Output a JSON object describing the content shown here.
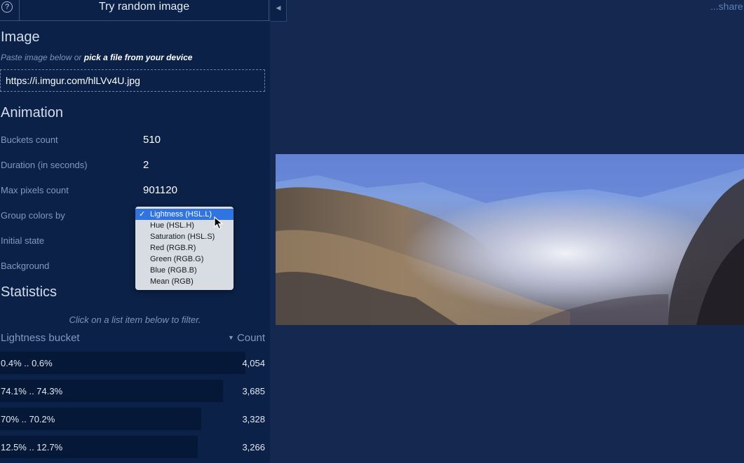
{
  "topbar": {
    "help_icon": "?",
    "random_button": "Try random image",
    "collapse_icon": "chevron-left-icon"
  },
  "image_section": {
    "title": "Image",
    "hint_prefix": "Paste image below or ",
    "hint_link": "pick a file from your device",
    "url_value": "https://i.imgur.com/hlLVv4U.jpg"
  },
  "animation": {
    "title": "Animation",
    "rows": [
      {
        "label": "Buckets count",
        "value": "510"
      },
      {
        "label": "Duration (in seconds)",
        "value": "2"
      },
      {
        "label": "Max pixels count",
        "value": "901120"
      },
      {
        "label": "Group colors by",
        "value": "Lightness (HSL.L)"
      },
      {
        "label": "Initial state",
        "value": ""
      },
      {
        "label": "Background",
        "value": ""
      }
    ],
    "group_by_options": [
      "Lightness (HSL.L)",
      "Hue (HSL.H)",
      "Saturation (HSL.S)",
      "Red (RGB.R)",
      "Green (RGB.G)",
      "Blue (RGB.B)",
      "Mean (RGB)"
    ],
    "selected_option_index": 0
  },
  "statistics": {
    "title": "Statistics",
    "hint": "Click on a list item below to filter.",
    "column_bucket": "Lightness bucket",
    "column_count": "Count",
    "rows": [
      {
        "bucket": "0.4% .. 0.6%",
        "count": "4,054",
        "fraction": 1.0
      },
      {
        "bucket": "74.1% .. 74.3%",
        "count": "3,685",
        "fraction": 0.909
      },
      {
        "bucket": "70% .. 70.2%",
        "count": "3,328",
        "fraction": 0.821
      },
      {
        "bucket": "12.5% .. 12.7%",
        "count": "3,266",
        "fraction": 0.806
      }
    ]
  },
  "header_right": {
    "share": "...share"
  },
  "colors": {
    "panel_bg": "#0b2147",
    "main_bg": "#142850",
    "selected_option": "#2f74e0",
    "stat_bar": "#061837"
  }
}
